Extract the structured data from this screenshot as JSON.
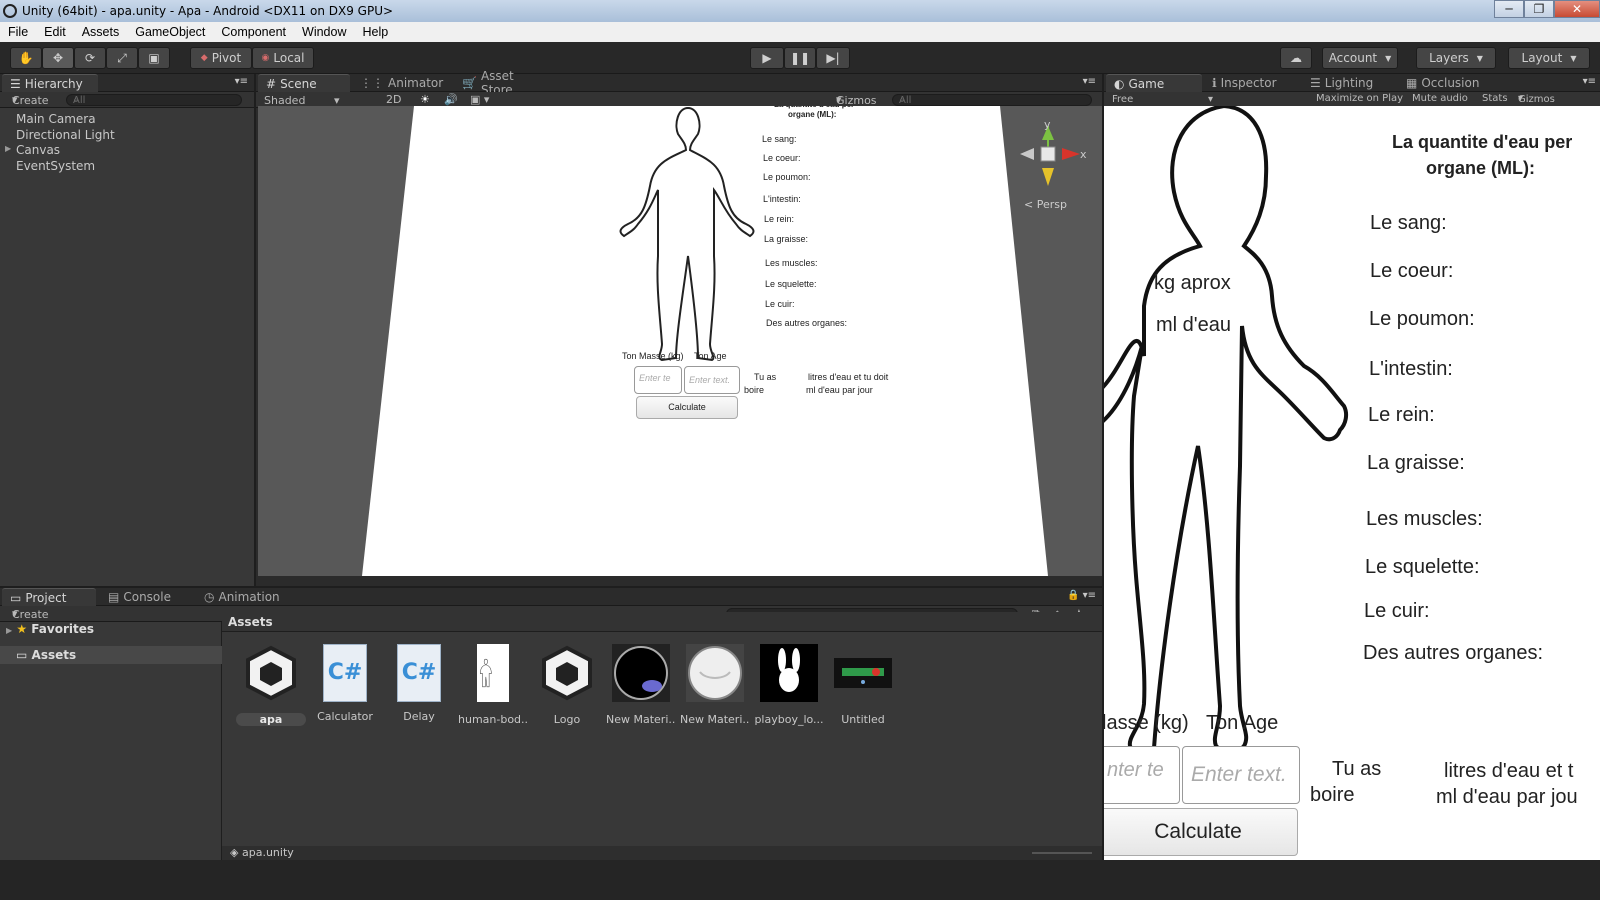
{
  "window": {
    "title": "Unity (64bit) - apa.unity - Apa - Android <DX11 on DX9 GPU>",
    "min": "─",
    "max": "❐",
    "close": "✕"
  },
  "menu": [
    "File",
    "Edit",
    "Assets",
    "GameObject",
    "Component",
    "Window",
    "Help"
  ],
  "toolbar": {
    "pivot": "Pivot",
    "local": "Local",
    "account": "Account",
    "layers": "Layers",
    "layout": "Layout"
  },
  "hierarchy": {
    "tab": "Hierarchy",
    "create": "Create",
    "search": "All",
    "items": [
      "Main Camera",
      "Directional Light",
      "Canvas",
      "EventSystem"
    ]
  },
  "scene": {
    "tabs": [
      "Scene",
      "Animator",
      "Asset Store"
    ],
    "shading": "Shaded",
    "mode2d": "2D",
    "gizmos": "Gizmos",
    "search": "All",
    "axis_x": "x",
    "axis_y": "y",
    "persp": "Persp"
  },
  "ui": {
    "header_line1": "La quantite d'eau per",
    "header_line2": "organe (ML):",
    "organs": [
      "Le sang:",
      "Le coeur:",
      "Le poumon:",
      "L'intestin:",
      "Le rein:",
      "La graisse:",
      "Les muscles:",
      "Le squelette:",
      "Le cuir:",
      "Des autres organes:"
    ],
    "kg_label": "kg aprox",
    "ml_label": "ml d'eau",
    "mass_label": "Ton Masse (kg)",
    "mass_label_game": "lasse (kg)",
    "age_label": "Ton Age",
    "input_placeholder_scene": "Enter te",
    "input_placeholder_game": "nter te",
    "input2_placeholder": "Enter text.",
    "tu_as": "Tu as",
    "boire": "boire",
    "litres_scene": "litres d'eau et tu doit",
    "litres_game": "litres d'eau et t",
    "ml_jour_scene": "ml d'eau par jour",
    "ml_jour_game": "ml d'eau par jou",
    "calculate": "Calculate"
  },
  "game": {
    "tabs": [
      "Game",
      "Inspector",
      "Lighting",
      "Occlusion"
    ],
    "aspect": "Free Aspect",
    "options": [
      "Maximize on Play",
      "Mute audio",
      "Stats",
      "Gizmos"
    ]
  },
  "project": {
    "tabs": [
      "Project",
      "Console",
      "Animation"
    ],
    "create": "Create",
    "favorites": "Favorites",
    "assets_root": "Assets",
    "assets_header": "Assets",
    "assets": [
      "apa",
      "Calculator",
      "Delay",
      "human-bod...",
      "Logo",
      "New Materi...",
      "New Materi...",
      "playboy_lo...",
      "Untitled"
    ],
    "selected_path": "apa.unity"
  },
  "colors": {
    "unity_dark": "#383838",
    "tab_bg": "#2b2b2b",
    "play_area": "#585858",
    "accent_red": "#d9342b",
    "accent_green": "#7cc242",
    "accent_yellow": "#e6c22a"
  }
}
